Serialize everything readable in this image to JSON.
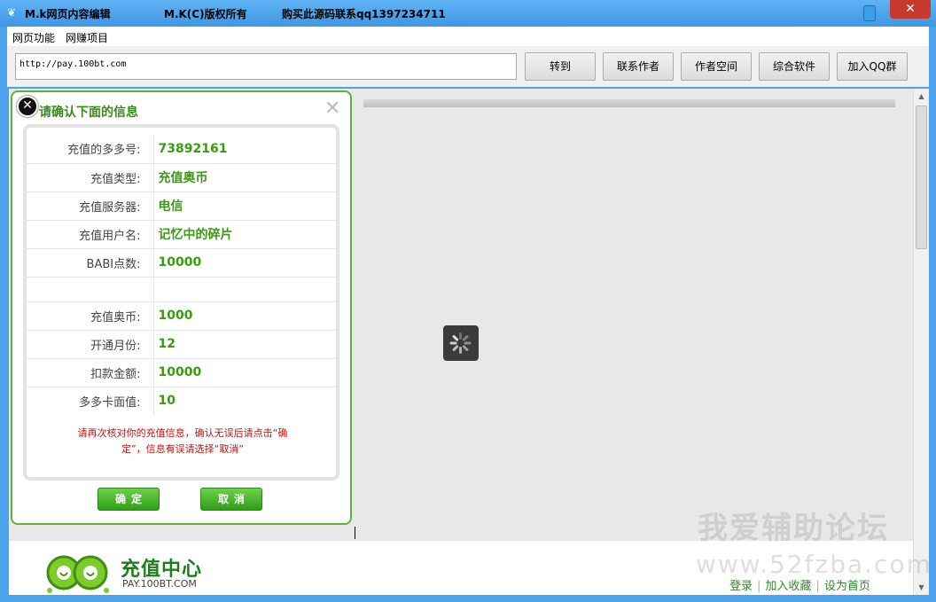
{
  "window": {
    "title_part1": "M.k网页内容编辑",
    "title_part2": "M.K(C)版权所有",
    "title_part3": "购买此源码联系qq1397234711",
    "close_glyph": "✕"
  },
  "menu": {
    "items": [
      "网页功能",
      "网赚项目"
    ]
  },
  "toolbar": {
    "url_value": "http://pay.100bt.com",
    "buttons": [
      "转到",
      "联系作者",
      "作者空间",
      "综合软件",
      "加入QQ群"
    ]
  },
  "dialog": {
    "title": "请确认下面的信息",
    "rows": [
      {
        "label": "充值的多多号:",
        "value": "73892161"
      },
      {
        "label": "充值类型:",
        "value": "充值奥币"
      },
      {
        "label": "充值服务器:",
        "value": "电信"
      },
      {
        "label": "充值用户名:",
        "value": "记忆中的碎片"
      },
      {
        "label": "BABI点数:",
        "value": "10000"
      },
      {
        "label": "",
        "value": ""
      },
      {
        "label": "充值奥币:",
        "value": "1000"
      },
      {
        "label": "开通月份:",
        "value": "12"
      },
      {
        "label": "扣款金额:",
        "value": "10000"
      },
      {
        "label": "多多卡面值:",
        "value": "10"
      }
    ],
    "notice_line1": "请再次核对你的充值信息，确认无误后请点击“确",
    "notice_line2": "定”，信息有误请选择“取消”",
    "ok_label": "确定",
    "cancel_label": "取消"
  },
  "footer": {
    "logo_title": "充值中心",
    "logo_subtitle": "PAY.100BT.COM",
    "links": [
      "登录",
      "加入收藏",
      "设为首页"
    ]
  },
  "watermark": {
    "line1": "我爱辅助论坛",
    "line2": "www.52fzba.com"
  },
  "colors": {
    "accent_green": "#5ab530",
    "value_green": "#3a9a10",
    "notice_red": "#c41010",
    "titlebar_blue": "#4ba3ec"
  }
}
